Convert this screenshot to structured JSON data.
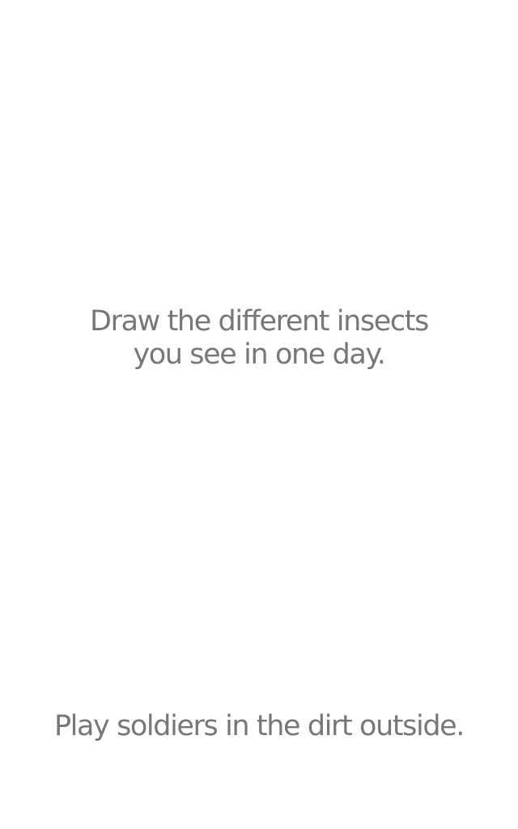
{
  "prompts": {
    "top": {
      "line1": "Draw the different insects",
      "line2": "you see in one day."
    },
    "bottom": {
      "line1": "Play soldiers in the dirt outside."
    }
  },
  "colors": {
    "background": "#ffffff",
    "text": "#777777"
  }
}
